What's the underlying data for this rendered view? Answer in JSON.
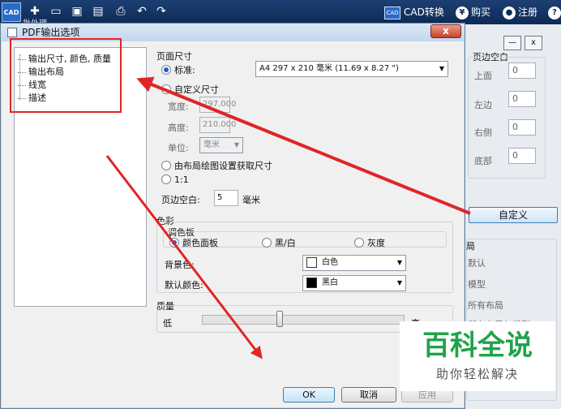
{
  "app": {
    "logo_text": "CAD",
    "right_items": {
      "cad_convert": "CAD转换",
      "buy": "购买",
      "register": "注册",
      "help": "?"
    },
    "partial_text": "批处理"
  },
  "dialog": {
    "title": "PDF输出选项",
    "close": "x",
    "tree": [
      "输出尺寸, 颜色, 质量",
      "输出布局",
      "线宽",
      "描述"
    ],
    "page_size": {
      "title": "页面尺寸",
      "standard_label": "标准:",
      "standard_value": "A4 297 x 210 毫米 (11.69 x 8.27 \")",
      "custom_label": "自定义尺寸",
      "width_label": "宽度:",
      "width_value": "297.000",
      "height_label": "高度:",
      "height_value": "210.000",
      "unit_label": "单位:",
      "unit_value": "毫米",
      "from_layout_label": "由布局绘图设置获取尺寸",
      "one_to_one_label": "1:1",
      "margin_label": "页边空白:",
      "margin_value": "5",
      "margin_unit": "毫米"
    },
    "color": {
      "title": "色彩",
      "palette_title": "调色板",
      "palette_options": [
        "颜色面板",
        "黑/白",
        "灰度"
      ],
      "bg_label": "背景色:",
      "bg_value": "白色",
      "default_label": "默认颜色:",
      "default_value": "黑白"
    },
    "quality": {
      "title": "质量",
      "low": "低",
      "high": "高"
    },
    "buttons": {
      "ok": "OK",
      "cancel": "取消",
      "apply": "应用"
    }
  },
  "bg_window": {
    "margin_title": "页边空白",
    "margins": [
      {
        "label": "上面",
        "value": "0"
      },
      {
        "label": "左边",
        "value": "0"
      },
      {
        "label": "右侧",
        "value": "0"
      },
      {
        "label": "底部",
        "value": "0"
      }
    ],
    "custom_btn": "自定义",
    "layout_title": "局",
    "layout_items": [
      "默认",
      "模型",
      "所有布局",
      "所有布局与模型"
    ]
  },
  "watermark": {
    "main": "百科全说",
    "sub": "助你轻松解决"
  },
  "colors": {
    "annotation_red": "#e02525",
    "watermark_green": "#1fa34a"
  }
}
